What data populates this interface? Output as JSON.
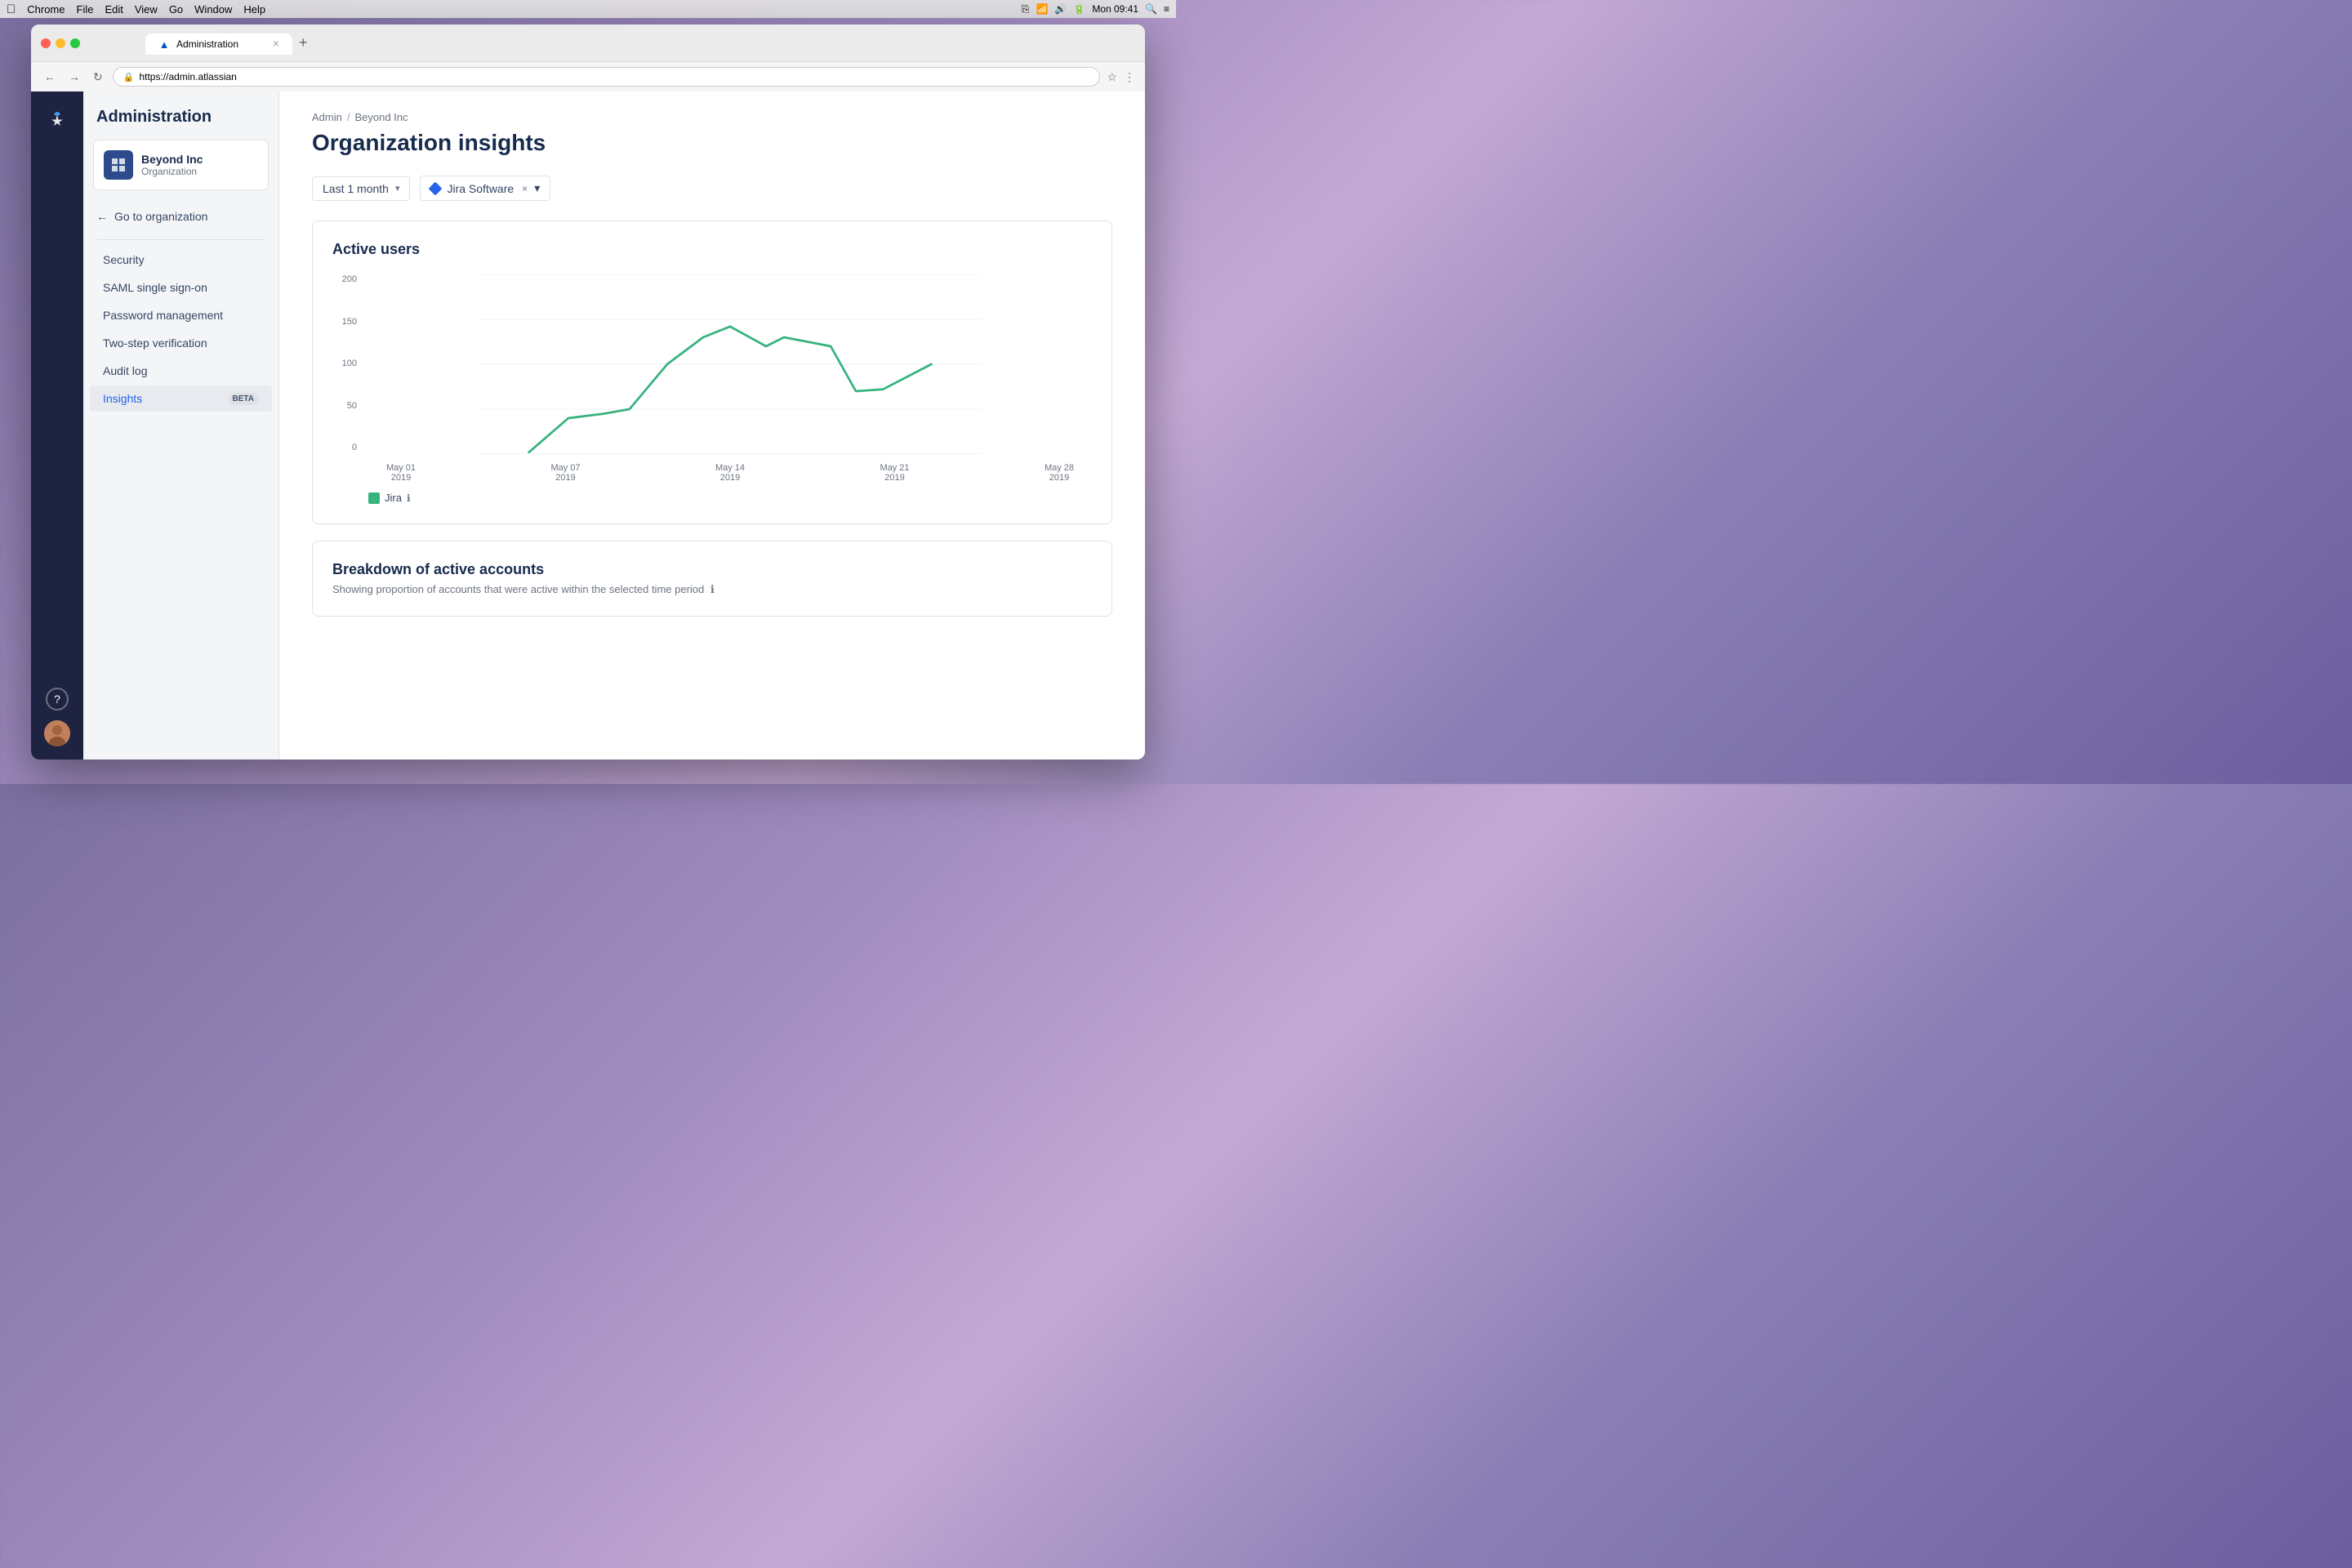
{
  "os": {
    "menu_bar": {
      "apple": "&#63743;",
      "app_name": "Chrome",
      "menus": [
        "File",
        "Edit",
        "View",
        "Go",
        "Window",
        "Help"
      ],
      "time": "Mon 09:41"
    }
  },
  "browser": {
    "tab_title": "Administration",
    "tab_favicon": "▲",
    "url": "https://admin.atlassian",
    "new_tab_label": "+"
  },
  "atlassian": {
    "logo": "▲"
  },
  "sidebar": {
    "title": "Administration",
    "org": {
      "name": "Beyond Inc",
      "type": "Organization",
      "icon": "▦"
    },
    "go_to_org": "Go to organization",
    "nav_items": [
      {
        "label": "Security",
        "active": false
      },
      {
        "label": "SAML single sign-on",
        "active": false
      },
      {
        "label": "Password management",
        "active": false
      },
      {
        "label": "Two-step verification",
        "active": false
      },
      {
        "label": "Audit log",
        "active": false
      },
      {
        "label": "Insights",
        "active": true,
        "badge": "BETA"
      }
    ]
  },
  "main": {
    "breadcrumb": {
      "admin": "Admin",
      "separator": "/",
      "current": "Beyond Inc"
    },
    "page_title": "Organization insights",
    "filters": {
      "time_period": {
        "label": "Last 1 month",
        "chevron": "▾"
      },
      "product": {
        "label": "Jira Software",
        "remove": "×",
        "chevron": "▾"
      }
    },
    "active_users_chart": {
      "title": "Active users",
      "y_labels": [
        "200",
        "150",
        "100",
        "50",
        "0"
      ],
      "x_labels": [
        {
          "line1": "May 01",
          "line2": "2019"
        },
        {
          "line1": "May 07",
          "line2": "2019"
        },
        {
          "line1": "May 14",
          "line2": "2019"
        },
        {
          "line1": "May 21",
          "line2": "2019"
        },
        {
          "line1": "May 28",
          "line2": "2019"
        }
      ],
      "legend": {
        "color": "#36b37e",
        "label": "Jira",
        "info": "ℹ"
      },
      "line_color": "#36b37e"
    },
    "breakdown": {
      "title": "Breakdown of active accounts",
      "subtitle": "Showing proportion of accounts that were active within the selected time period"
    }
  },
  "bottom_sidebar": {
    "help_label": "?",
    "avatar_label": "👤"
  }
}
